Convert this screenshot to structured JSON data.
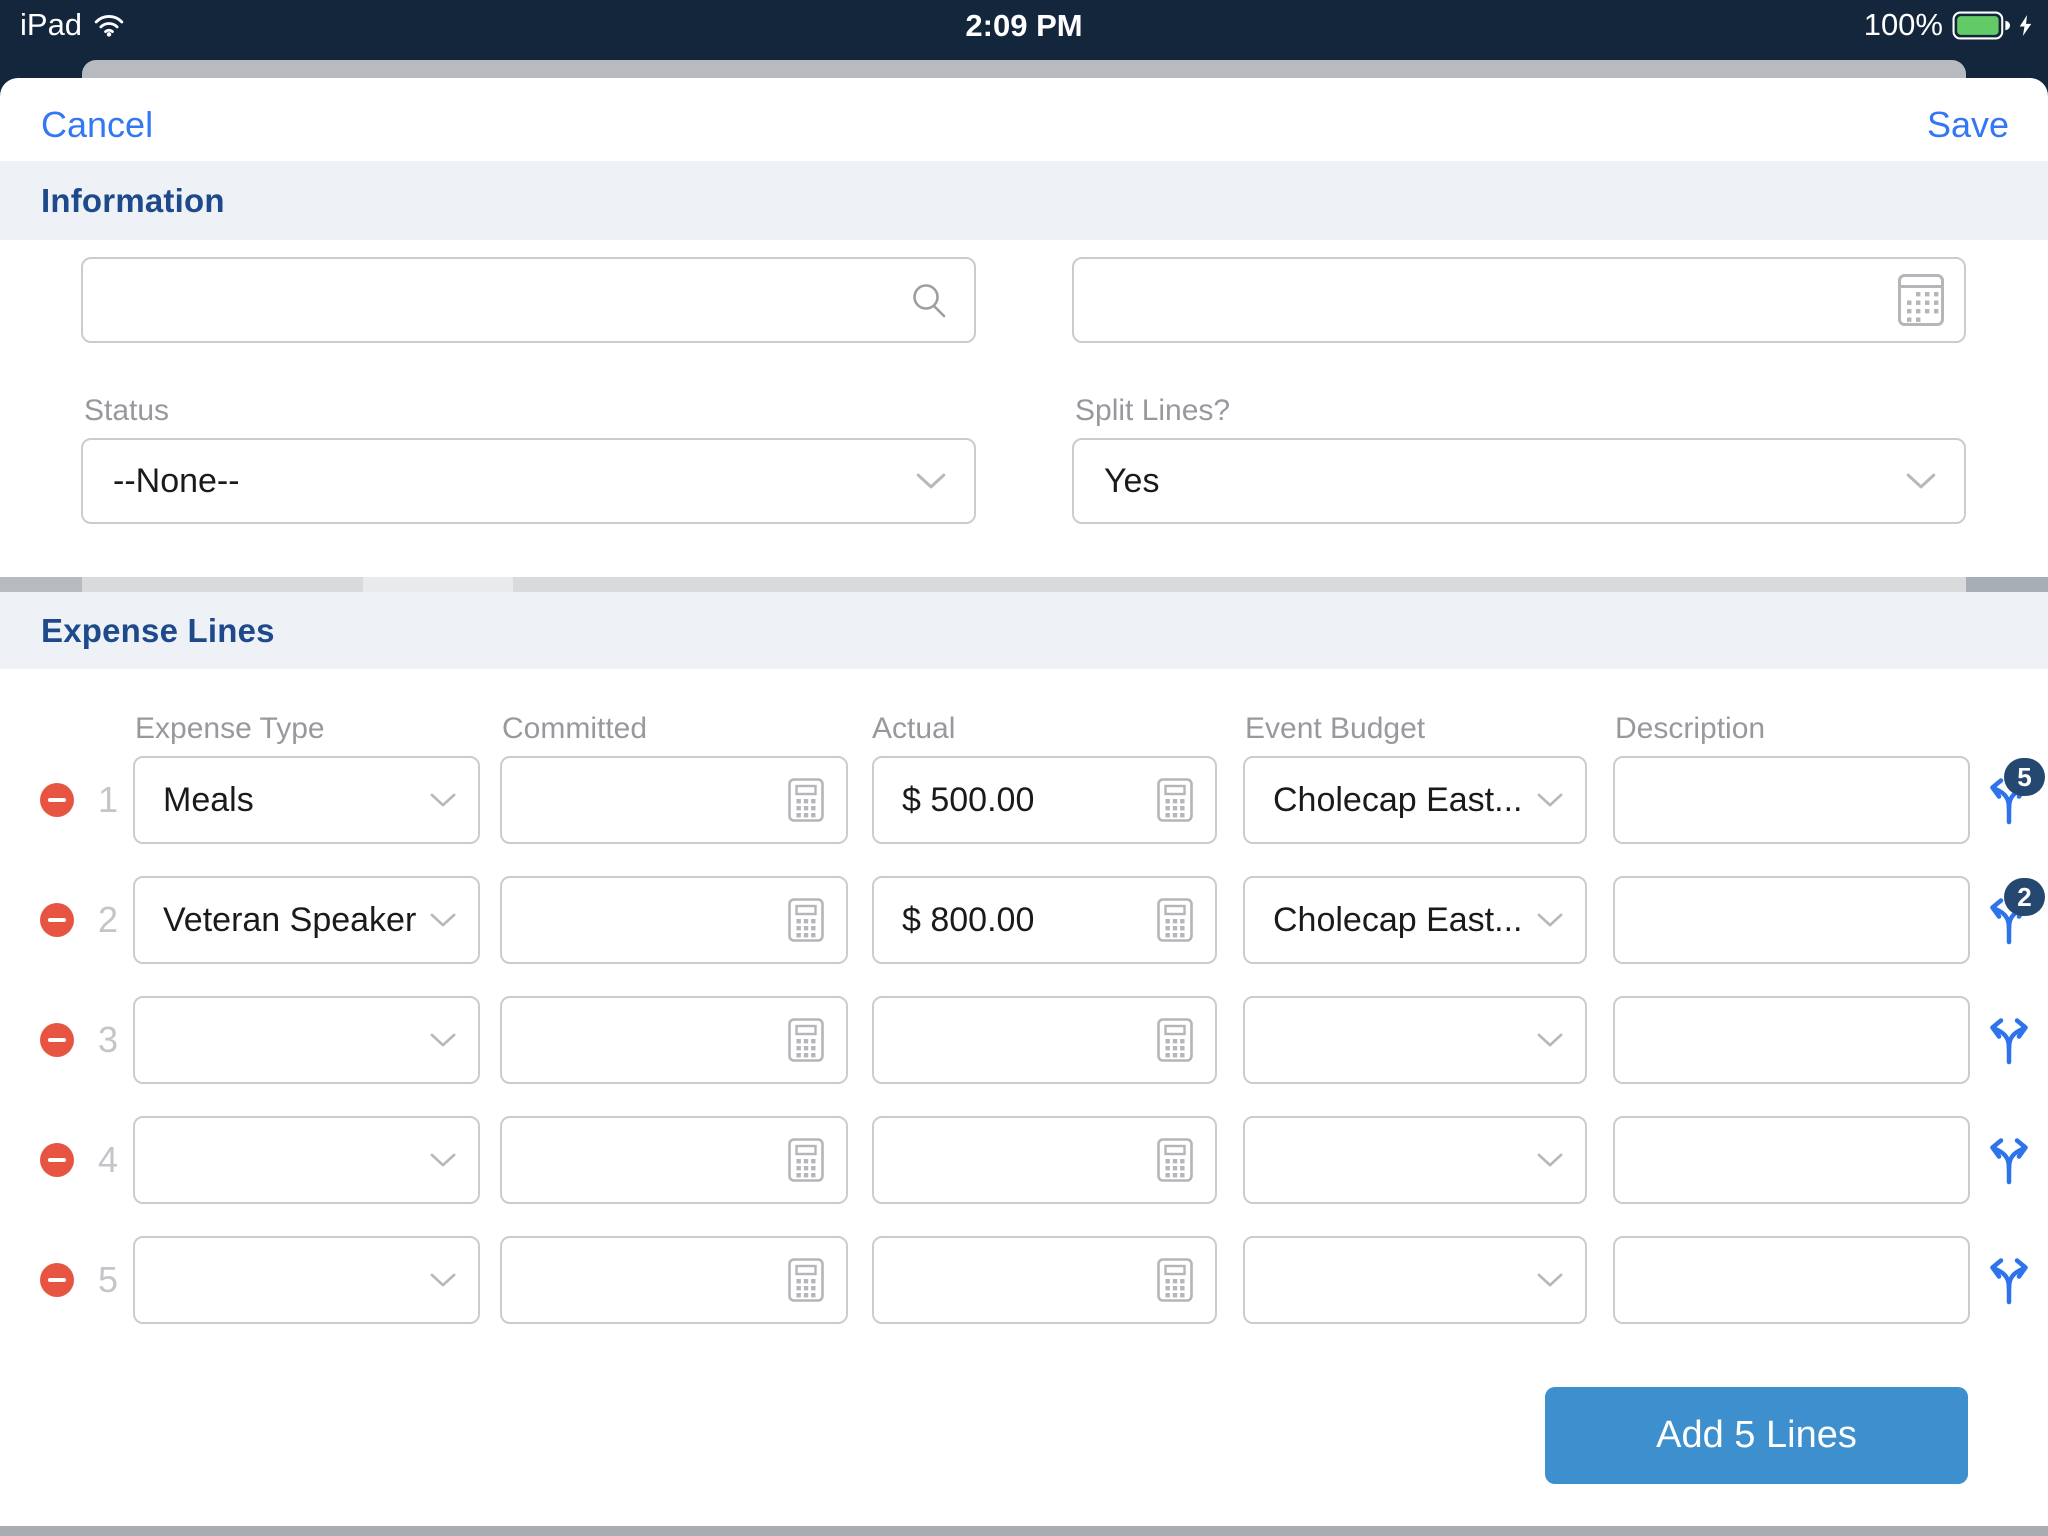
{
  "status_bar": {
    "carrier": "iPad",
    "time": "2:09 PM",
    "battery_percent": "100%"
  },
  "nav": {
    "cancel_label": "Cancel",
    "save_label": "Save"
  },
  "info_section": {
    "title": "Information",
    "lookup_field": {
      "value": "",
      "icon": "search-icon"
    },
    "date_field": {
      "value": "",
      "icon": "calendar-icon"
    },
    "status": {
      "label": "Status",
      "value": "--None--"
    },
    "split_lines": {
      "label": "Split Lines?",
      "value": "Yes"
    }
  },
  "expense_section": {
    "title": "Expense Lines",
    "columns": {
      "expense_type": "Expense Type",
      "committed": "Committed",
      "actual": "Actual",
      "event_budget": "Event Budget",
      "description": "Description"
    },
    "rows": [
      {
        "num": "1",
        "expense_type": "Meals",
        "committed": "",
        "actual": "$ 500.00",
        "event_budget": "Cholecap East...",
        "description": "",
        "split_count": "5"
      },
      {
        "num": "2",
        "expense_type": "Veteran Speaker",
        "committed": "",
        "actual": "$ 800.00",
        "event_budget": "Cholecap East...",
        "description": "",
        "split_count": "2"
      },
      {
        "num": "3",
        "expense_type": "",
        "committed": "",
        "actual": "",
        "event_budget": "",
        "description": "",
        "split_count": ""
      },
      {
        "num": "4",
        "expense_type": "",
        "committed": "",
        "actual": "",
        "event_budget": "",
        "description": "",
        "split_count": ""
      },
      {
        "num": "5",
        "expense_type": "",
        "committed": "",
        "actual": "",
        "event_budget": "",
        "description": "",
        "split_count": ""
      }
    ],
    "add_button_label": "Add 5 Lines"
  },
  "colors": {
    "status_bar_navy": "#13263C",
    "accent_blue": "#3377F2",
    "section_title_blue": "#1E4A8C",
    "add_button_blue": "#3E8FCE",
    "split_icon_blue": "#2E73E9",
    "badge_navy": "#24486F",
    "remove_red": "#E75442",
    "battery_green": "#63CB66"
  }
}
